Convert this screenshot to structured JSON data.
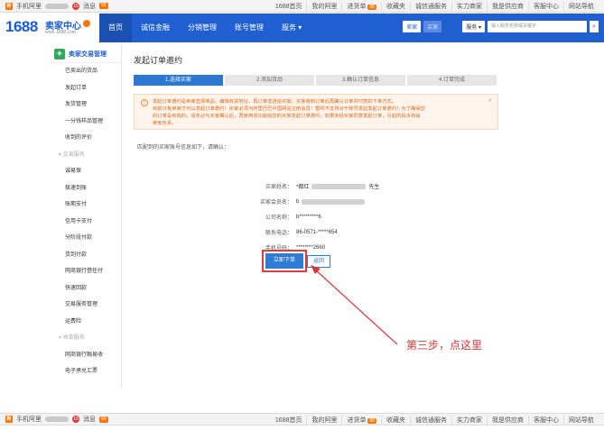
{
  "topbar": {
    "mobile_label": "手机阿里",
    "messages_label": "消息",
    "messages_count": "99",
    "avatar_badge": "16",
    "links": [
      "1688首页",
      "我的阿里",
      "进货单",
      "收藏夹",
      "诚信通服务",
      "实力商家",
      "我是供应商",
      "客服中心",
      "网站导航"
    ],
    "cart_count": "88"
  },
  "header": {
    "logo_text": "1688",
    "logo_center": "卖家中心",
    "logo_url": "work.1688.com",
    "nav": [
      "首页",
      "诚信金融",
      "分销管理",
      "账号管理",
      "服务"
    ],
    "seller_label": "卖家",
    "buyer_label": "买家",
    "service_select": "服务",
    "search_placeholder": "输入服务名称或关键字"
  },
  "sidebar": {
    "title": "卖家交易管理",
    "items_top": [
      "已卖出的货品",
      "发起订单",
      "发货管理",
      "一分钱样品管理",
      "收到的评价"
    ],
    "group_trade": "交易服务",
    "items_trade": [
      "诚易保",
      "极速到账",
      "账期支付",
      "信用卡支付",
      "分阶段付款",
      "货到付款",
      "网商银行借任付",
      "快速回款",
      "交易服务管理",
      "运费险"
    ],
    "group_collect": "收款服务",
    "items_collect": [
      "网商银行融易收",
      "电子承兑汇票"
    ]
  },
  "main": {
    "page_title": "发起订单邀约",
    "steps": [
      "1.选择买家",
      "2.添加货品",
      "3.确认订单信息",
      "4.订单完成"
    ],
    "notice": [
      "发起订单邀约是卖家选择商品、编辑收货地址、再订单发送给买家，买家收到订单后再确认订单并付款的下单方式。",
      "目前只有卖家才可以发起订单邀约！买家必须为阿里巴巴中国网站注册会员！暂时不支持对于账号发起发起订单邀约！为了确保您",
      "的订单是有效的，请务必与买家确认后，再使用该功能给您的买家发起订单邀约。如果未经买家同意发起订单，引起的投诉将由",
      "卖家负责。"
    ],
    "confirm_text": "匹配到的买家账号信息如下，请确认：",
    "info": [
      {
        "label": "买家姓名：",
        "value": "先生"
      },
      {
        "label": "买家会员名：",
        "value": "b"
      },
      {
        "label": "公司名称：",
        "value": "b*********6"
      },
      {
        "label": "联系电话：",
        "value": "86-0571-*****654"
      },
      {
        "label": "手机号码：",
        "value": "********2660"
      }
    ],
    "submit_label": "立即下单",
    "cancel_label": "返回"
  },
  "annotation": {
    "text": "第三步，点这里",
    "color": "#d93636"
  }
}
